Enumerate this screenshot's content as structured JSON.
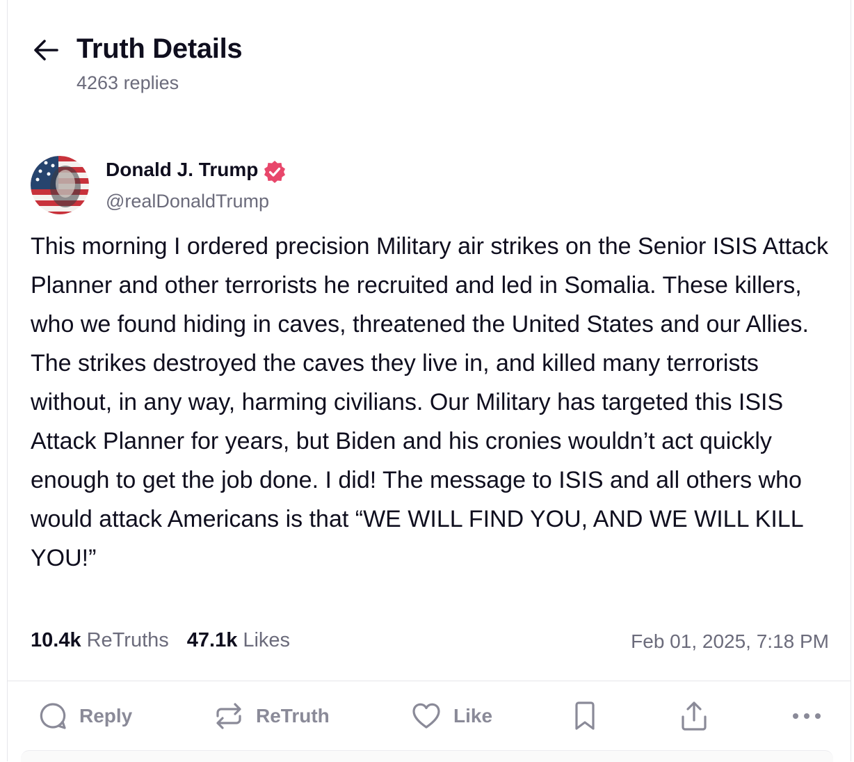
{
  "header": {
    "back_icon": "arrow-left-icon",
    "title": "Truth Details",
    "reply_count": "4263 replies"
  },
  "author": {
    "name": "Donald J. Trump",
    "handle": "@realDonaldTrump",
    "verified_badge_color": "#e8476b",
    "avatar_icon": "avatar-flag-portrait"
  },
  "post": {
    "text": "This morning I ordered precision Military air strikes on the Senior ISIS Attack Planner and other terrorists he recruited and led in Somalia. These killers, who we found hiding in caves, threatened the United States and our Allies. The strikes destroyed the caves they live in, and killed many terrorists without, in any way, harming civilians. Our Military has targeted this ISIS Attack Planner for years, but Biden and his cronies wouldn’t act quickly enough to get the job done. I did! The message to ISIS and all others who would attack Americans is that “WE WILL FIND YOU, AND WE WILL KILL YOU!”",
    "retruths_count": "10.4k",
    "retruths_label": "ReTruths",
    "likes_count": "47.1k",
    "likes_label": "Likes",
    "timestamp": "Feb 01, 2025, 7:18 PM"
  },
  "actions": {
    "reply_label": "Reply",
    "retruth_label": "ReTruth",
    "like_label": "Like",
    "icons": [
      "reply-icon",
      "retruth-icon",
      "like-icon",
      "bookmark-icon",
      "share-icon",
      "more-icon"
    ]
  },
  "colors": {
    "text": "#0f0e1e",
    "muted": "#6b6b7b",
    "action": "#8a8a98",
    "divider": "#e6e6ea"
  }
}
